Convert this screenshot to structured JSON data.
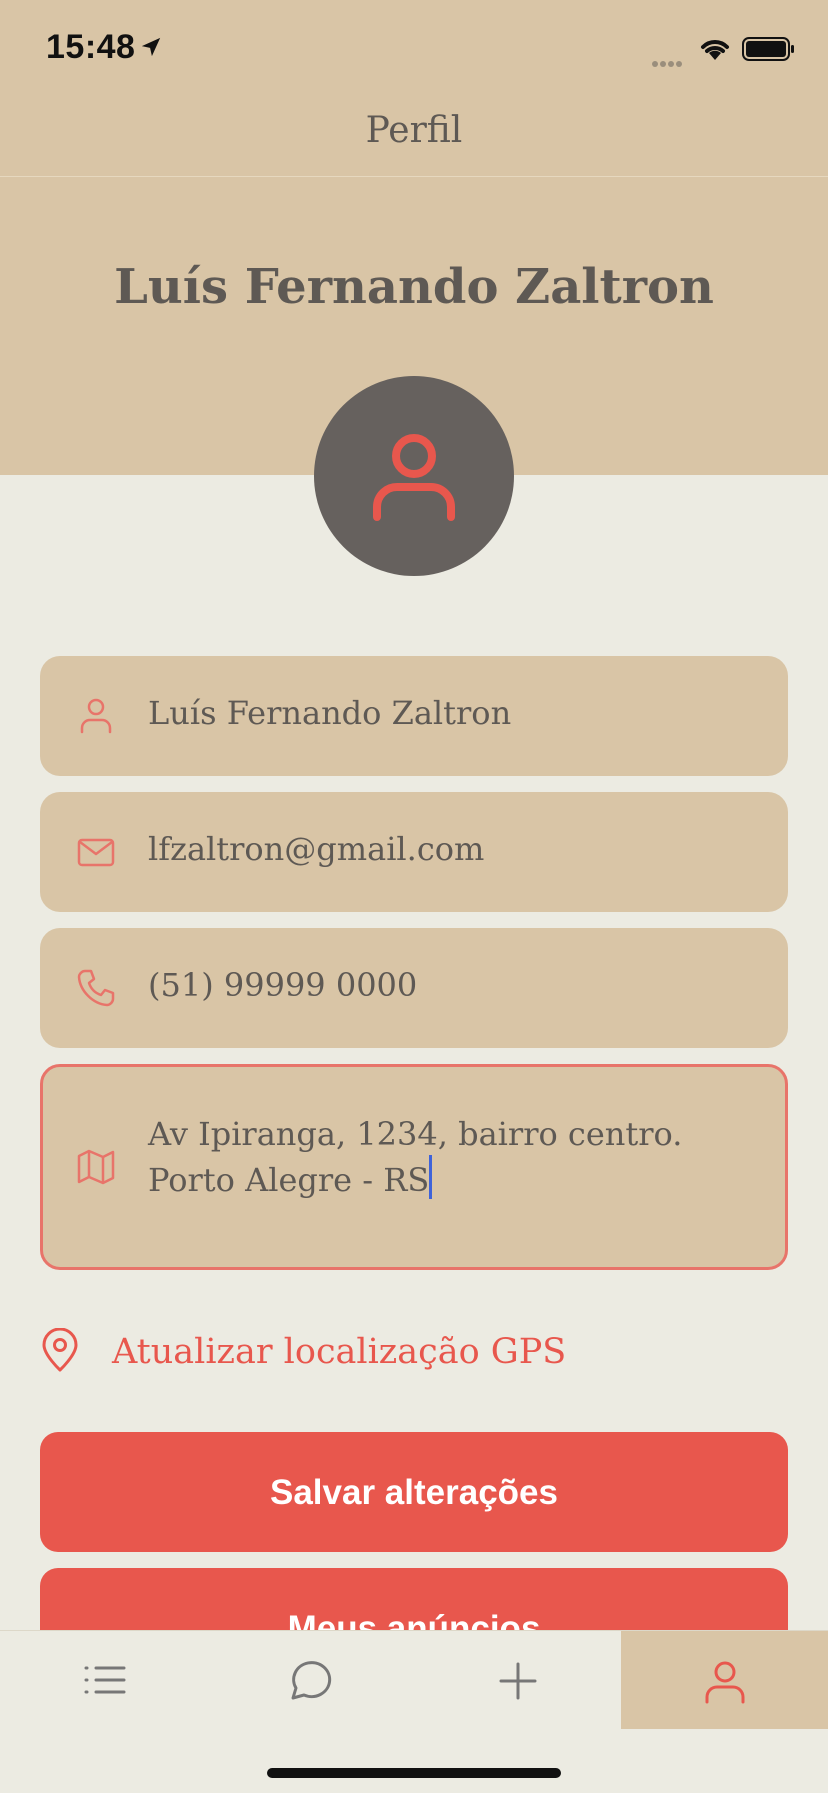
{
  "status_bar": {
    "time": "15:48"
  },
  "nav": {
    "title": "Perfil"
  },
  "profile": {
    "name": "Luís Fernando Zaltron",
    "fields": {
      "name": "Luís Fernando Zaltron",
      "email": "lfzaltron@gmail.com",
      "phone": "(51) 99999 0000",
      "address_line1": "Av Ipiranga, 1234, bairro centro.",
      "address_line2": "Porto Alegre - RS"
    }
  },
  "actions": {
    "gps_label": "Atualizar localização GPS",
    "save_label": "Salvar alterações",
    "my_ads_label": "Meus anúncios"
  },
  "tabs": [
    "list-icon",
    "chat-icon",
    "add-icon",
    "user-icon"
  ],
  "colors": {
    "accent": "#e8574d",
    "sand": "#d9c5a6",
    "background": "#ecebe2",
    "text": "#5e5954"
  }
}
